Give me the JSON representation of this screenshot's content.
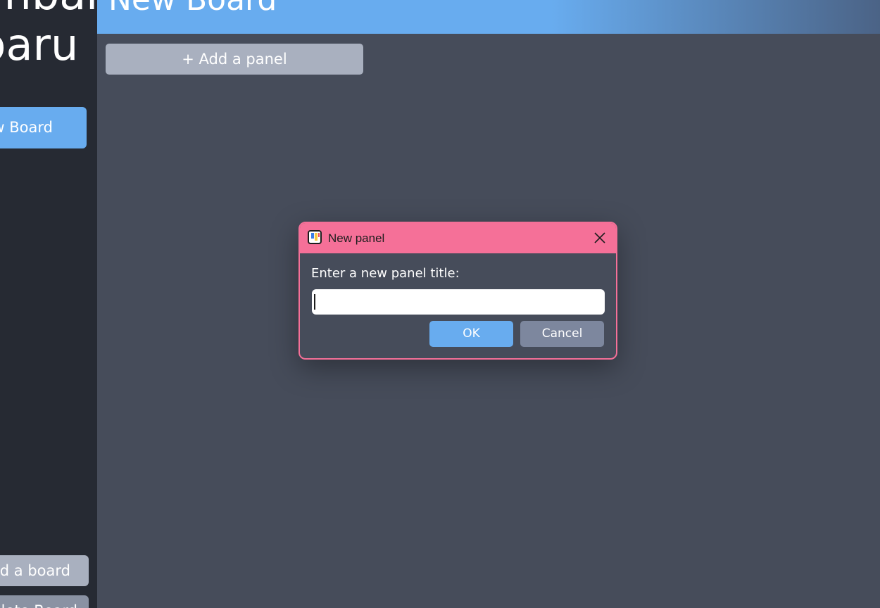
{
  "sidebar": {
    "app_title": "Kanban\nBoaru",
    "current_board_label": "New Board",
    "add_board_label": "Add a board",
    "delete_board_label": "Delete Board"
  },
  "header": {
    "board_title": "New Board"
  },
  "main": {
    "add_panel_label": "+ Add a panel"
  },
  "dialog": {
    "title": "New panel",
    "prompt": "Enter a new panel title:",
    "input_value": "",
    "ok_label": "OK",
    "cancel_label": "Cancel"
  },
  "colors": {
    "accent_blue": "#68acef",
    "dialog_pink": "#f57098",
    "sidebar_bg": "#262a33",
    "main_bg": "#464c5a",
    "secondary_button": "#a9b0bf"
  },
  "icons": {
    "app_icon": "kanban-app-icon",
    "close_icon": "close-icon"
  }
}
